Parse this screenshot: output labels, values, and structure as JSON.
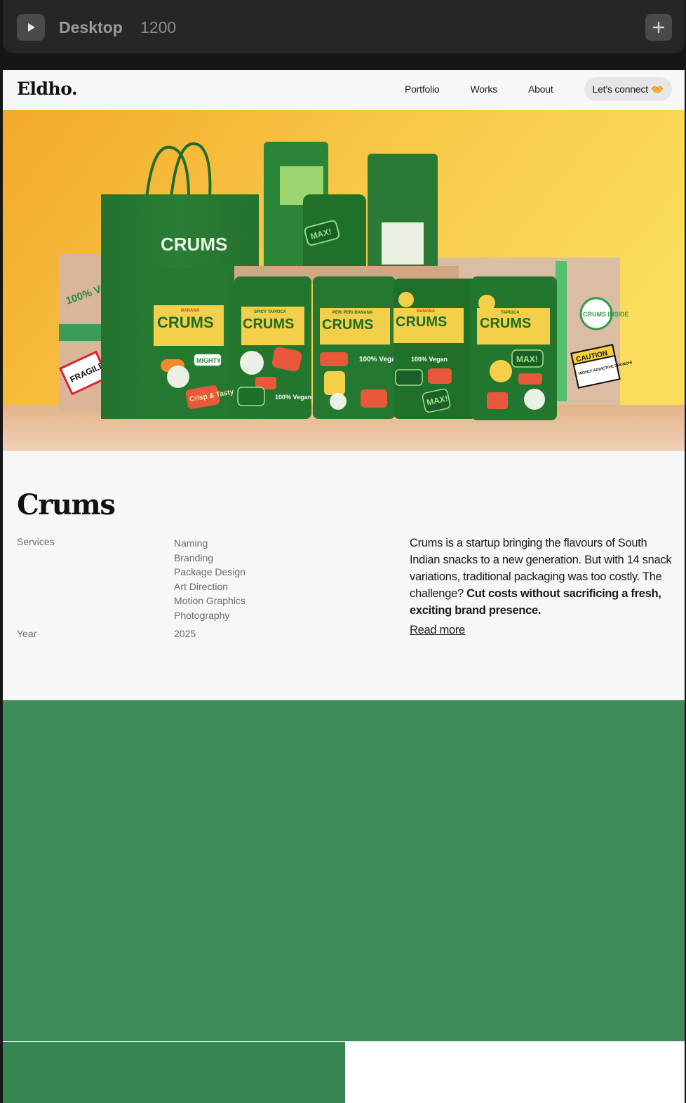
{
  "toolbar": {
    "breakpoint_name": "Desktop",
    "breakpoint_width": "1200"
  },
  "nav": {
    "logo": "Eldho.",
    "links": [
      "Portfolio",
      "Works",
      "About"
    ],
    "connect_label": "Let's connect"
  },
  "hero": {
    "bag_brand": "CRUMS",
    "box_sticker_vegan": "100% Vegan",
    "box_sticker_fragile": "FRAGILE",
    "box_sticker_inside": "CRUMS INSIDE",
    "box_sticker_caution": "CAUTION",
    "box_sticker_caution_sub": "HIGHLY ADDICTIVE CRUNCH!",
    "bag_flavours": [
      "BANANA",
      "SPICY TAPIOCA",
      "PERI PERI BANANA",
      "BANANA",
      "TAPIOCA"
    ],
    "stickers": [
      "MIGHTY!",
      "MAX!",
      "100% Vegan",
      "Crisp & Tasty"
    ],
    "colors": {
      "sky_top": "#fbd95a",
      "sky_bottom": "#f2aa2e",
      "bag_green": "#23752f",
      "label_yellow": "#f4cf4a",
      "box_kraft": "#d7b79a"
    }
  },
  "project": {
    "title": "Crums",
    "services_label": "Services",
    "services": [
      "Naming",
      "Branding",
      "Package Design",
      "Art Direction",
      "Motion Graphics",
      "Photography"
    ],
    "year_label": "Year",
    "year": "2025",
    "description_plain": "Crums is a startup bringing the flavours of South Indian snacks to a new generation. But with 14 snack variations, traditional packaging was too costly. The challenge?",
    "description_bold": "Cut costs without sacrificing a fresh, exciting brand presence.",
    "read_more": "Read more"
  },
  "colors": {
    "green_block": "#3f8b59",
    "green_small": "#378550",
    "page_bg": "#f7f7f7"
  }
}
